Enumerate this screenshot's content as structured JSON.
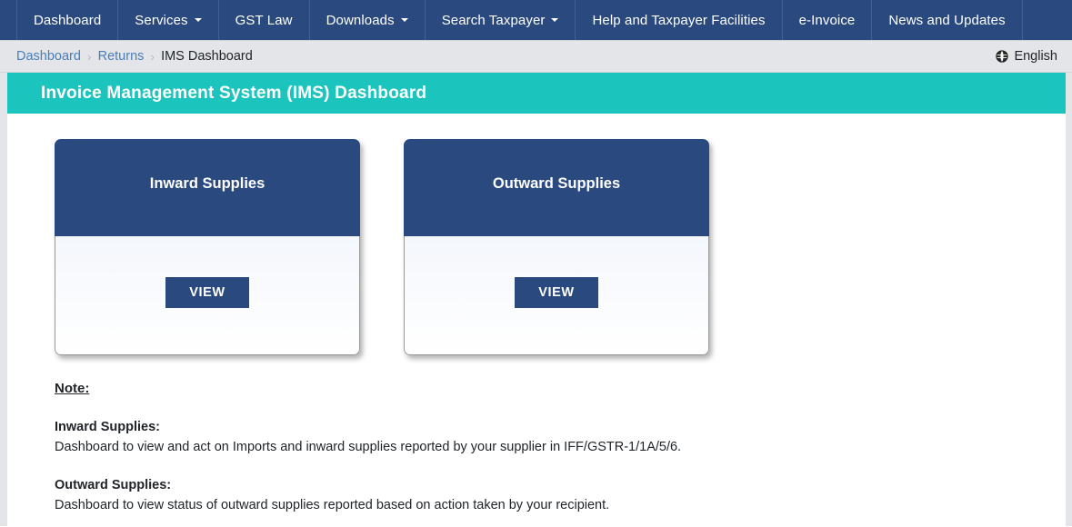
{
  "nav": {
    "items": [
      {
        "label": "Dashboard",
        "has_caret": false
      },
      {
        "label": "Services",
        "has_caret": true
      },
      {
        "label": "GST Law",
        "has_caret": false
      },
      {
        "label": "Downloads",
        "has_caret": true
      },
      {
        "label": "Search Taxpayer",
        "has_caret": true
      },
      {
        "label": "Help and Taxpayer Facilities",
        "has_caret": false
      },
      {
        "label": "e-Invoice",
        "has_caret": false
      },
      {
        "label": "News and Updates",
        "has_caret": false
      }
    ]
  },
  "breadcrumb": {
    "items": [
      {
        "label": "Dashboard",
        "link": true
      },
      {
        "label": "Returns",
        "link": true
      },
      {
        "label": "IMS Dashboard",
        "link": false
      }
    ],
    "separator": "›"
  },
  "language": {
    "icon": "globe-icon",
    "label": "English"
  },
  "header": {
    "title": "Invoice Management System (IMS) Dashboard"
  },
  "cards": [
    {
      "title": "Inward Supplies",
      "button_label": "VIEW"
    },
    {
      "title": "Outward Supplies",
      "button_label": "VIEW"
    }
  ],
  "note": {
    "title": "Note:",
    "blocks": [
      {
        "heading": "Inward Supplies:",
        "text": "Dashboard to view and act on Imports and inward supplies reported by your supplier in IFF/GSTR-1/1A/5/6."
      },
      {
        "heading": "Outward Supplies:",
        "text": "Dashboard to view status of outward supplies reported based on action taken by your recipient."
      }
    ]
  },
  "colors": {
    "nav_bg": "#2a4a7f",
    "accent_teal": "#1bc5bd",
    "breadcrumb_link": "#4a7ebb",
    "page_bg": "#e3e5e8"
  }
}
